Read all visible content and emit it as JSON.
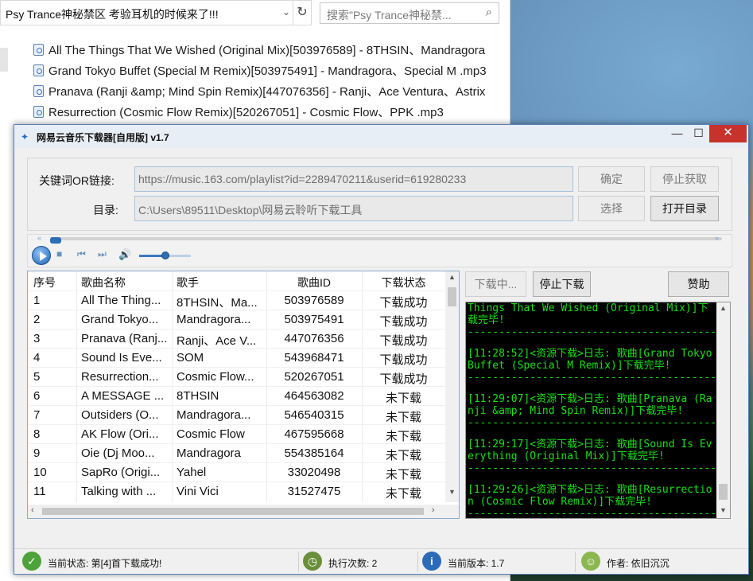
{
  "explorer": {
    "address": "Psy Trance神秘禁区 考验耳机的时候来了!!!",
    "search_placeholder": "搜索\"Psy Trance神秘禁...",
    "files": [
      "All The Things That We Wished (Original Mix)[503976589] - 8THSIN、Mandragora",
      "Grand Tokyo Buffet (Special M Remix)[503975491] - Mandragora、Special M .mp3",
      "Pranava (Ranji &amp; Mind Spin Remix)[447076356] - Ranji、Ace Ventura、Astrix",
      "Resurrection (Cosmic Flow Remix)[520267051] - Cosmic Flow、PPK .mp3"
    ]
  },
  "app": {
    "title": "网易云音乐下载器[自用版] v1.7",
    "window_buttons": {
      "minimize": "—",
      "maximize": "☐",
      "close": "✕"
    },
    "keyword_label": "关键词OR链接:",
    "keyword_value": "https://music.163.com/playlist?id=2289470211&userid=619280233",
    "dir_label": "目录:",
    "dir_value": "C:\\Users\\89511\\Desktop\\网易云聆听下载工具",
    "buttons": {
      "confirm": "确定",
      "stop_fetch": "停止获取",
      "choose": "选择",
      "open_dir": "打开目录",
      "downloading": "下载中...",
      "stop_download": "停止下载",
      "donate": "赞助"
    },
    "player": {
      "seek_fraction": 0.0,
      "volume_fraction": 0.5
    }
  },
  "table": {
    "headers": [
      "序号",
      "歌曲名称",
      "歌手",
      "歌曲ID",
      "下载状态"
    ],
    "rows": [
      [
        "1",
        "All The Thing...",
        "8THSIN、Ma...",
        "503976589",
        "下载成功"
      ],
      [
        "2",
        "Grand Tokyo...",
        "Mandragora...",
        "503975491",
        "下载成功"
      ],
      [
        "3",
        "Pranava (Ranj...",
        "Ranji、Ace V...",
        "447076356",
        "下载成功"
      ],
      [
        "4",
        "Sound Is Eve...",
        "SOM",
        "543968471",
        "下载成功"
      ],
      [
        "5",
        "Resurrection...",
        "Cosmic Flow...",
        "520267051",
        "下载成功"
      ],
      [
        "6",
        " A MESSAGE ...",
        "8THSIN",
        "464563082",
        "未下载"
      ],
      [
        "7",
        "Outsiders (O...",
        "Mandragora...",
        "546540315",
        "未下载"
      ],
      [
        "8",
        "AK Flow (Ori...",
        "Cosmic Flow",
        "467595668",
        "未下载"
      ],
      [
        "9",
        "Oie (Dj Moo...",
        "Mandragora",
        "554385164",
        "未下载"
      ],
      [
        "10",
        "SapRo (Origi...",
        "Yahel",
        "33020498",
        "未下载"
      ],
      [
        "11",
        "Talking with ...",
        "Vini Vici",
        "31527475",
        "未下载"
      ]
    ]
  },
  "log": {
    "lines": [
      "Things That We Wished (Original Mix)]下载完毕!",
      "[11:28:52]<资源下载>日志: 歌曲[Grand Tokyo Buffet (Special M Remix)]下载完毕!",
      "[11:29:07]<资源下载>日志: 歌曲[Pranava (Ranji &amp; Mind Spin Remix)]下载完毕!",
      "[11:29:17]<资源下载>日志: 歌曲[Sound Is Everything (Original Mix)]下载完毕!",
      "[11:29:26]<资源下载>日志: 歌曲[Resurrection (Cosmic Flow Remix)]下载完毕!"
    ],
    "separator": "------------------------------------------------------"
  },
  "status": {
    "current": "当前状态: 第[4]首下载成功!",
    "exec_count": "执行次数: 2",
    "version": "当前版本: 1.7",
    "author": "作者: 依旧沉沉"
  },
  "colors": {
    "log_text": "#18e018",
    "log_bg": "#000000",
    "close_button": "#c7322c"
  }
}
